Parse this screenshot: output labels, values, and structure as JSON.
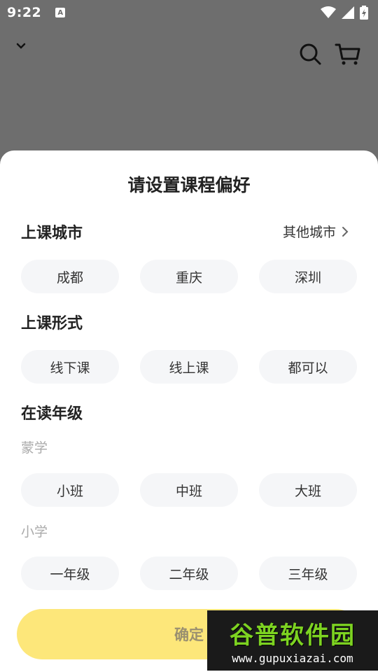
{
  "status_bar": {
    "time": "9:22",
    "notif_letter": "A"
  },
  "sheet": {
    "title": "请设置课程偏好",
    "city": {
      "title": "上课城市",
      "other_label": "其他城市",
      "options": [
        "成都",
        "重庆",
        "深圳"
      ]
    },
    "format": {
      "title": "上课形式",
      "options": [
        "线下课",
        "线上课",
        "都可以"
      ]
    },
    "grade": {
      "title": "在读年级",
      "groups": [
        {
          "label": "蒙学",
          "options": [
            "小班",
            "中班",
            "大班"
          ]
        },
        {
          "label": "小学",
          "options": [
            "一年级",
            "二年级",
            "三年级"
          ]
        }
      ]
    },
    "confirm_label": "确定"
  },
  "watermark": {
    "title": "谷普软件园",
    "url": "www.gupuxiazai.com"
  },
  "colors": {
    "confirm_bg": "#fde77a",
    "chip_bg": "#f5f6f8",
    "overlay": "#6e6e6e"
  }
}
